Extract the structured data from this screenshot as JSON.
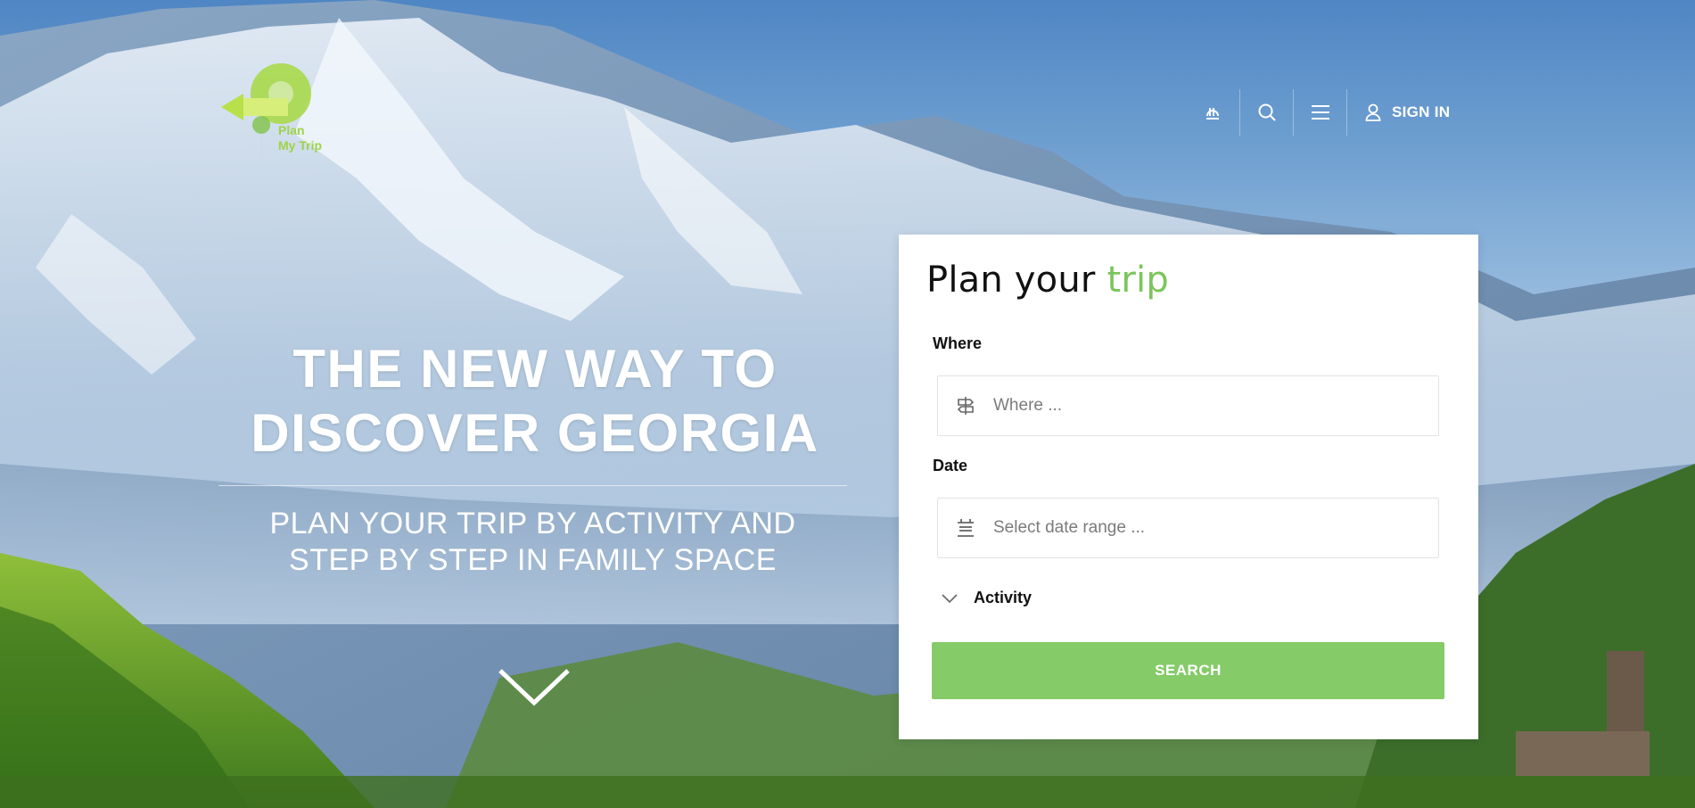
{
  "brand": {
    "logo_line1": "Plan",
    "logo_line2": "My Trip",
    "colors": {
      "accent": "#85cb68",
      "logo_green": "#9fd24a"
    }
  },
  "nav": {
    "icons": [
      "currency-icon",
      "search-icon",
      "menu-icon",
      "user-icon"
    ],
    "signin_label": "SIGN IN"
  },
  "hero": {
    "headline_line1": "THE NEW WAY TO",
    "headline_line2": "DISCOVER GEORGIA",
    "subline_line1": "PLAN YOUR TRIP BY ACTIVITY AND",
    "subline_line2": "STEP BY STEP IN FAMILY SPACE"
  },
  "planner": {
    "title_main": "Plan your",
    "title_accent": "trip",
    "where_label": "Where",
    "where_placeholder": "Where ...",
    "where_value": "",
    "date_label": "Date",
    "date_placeholder": "Select date range ...",
    "date_value": "",
    "activity_label": "Activity",
    "search_label": "SEARCH"
  }
}
